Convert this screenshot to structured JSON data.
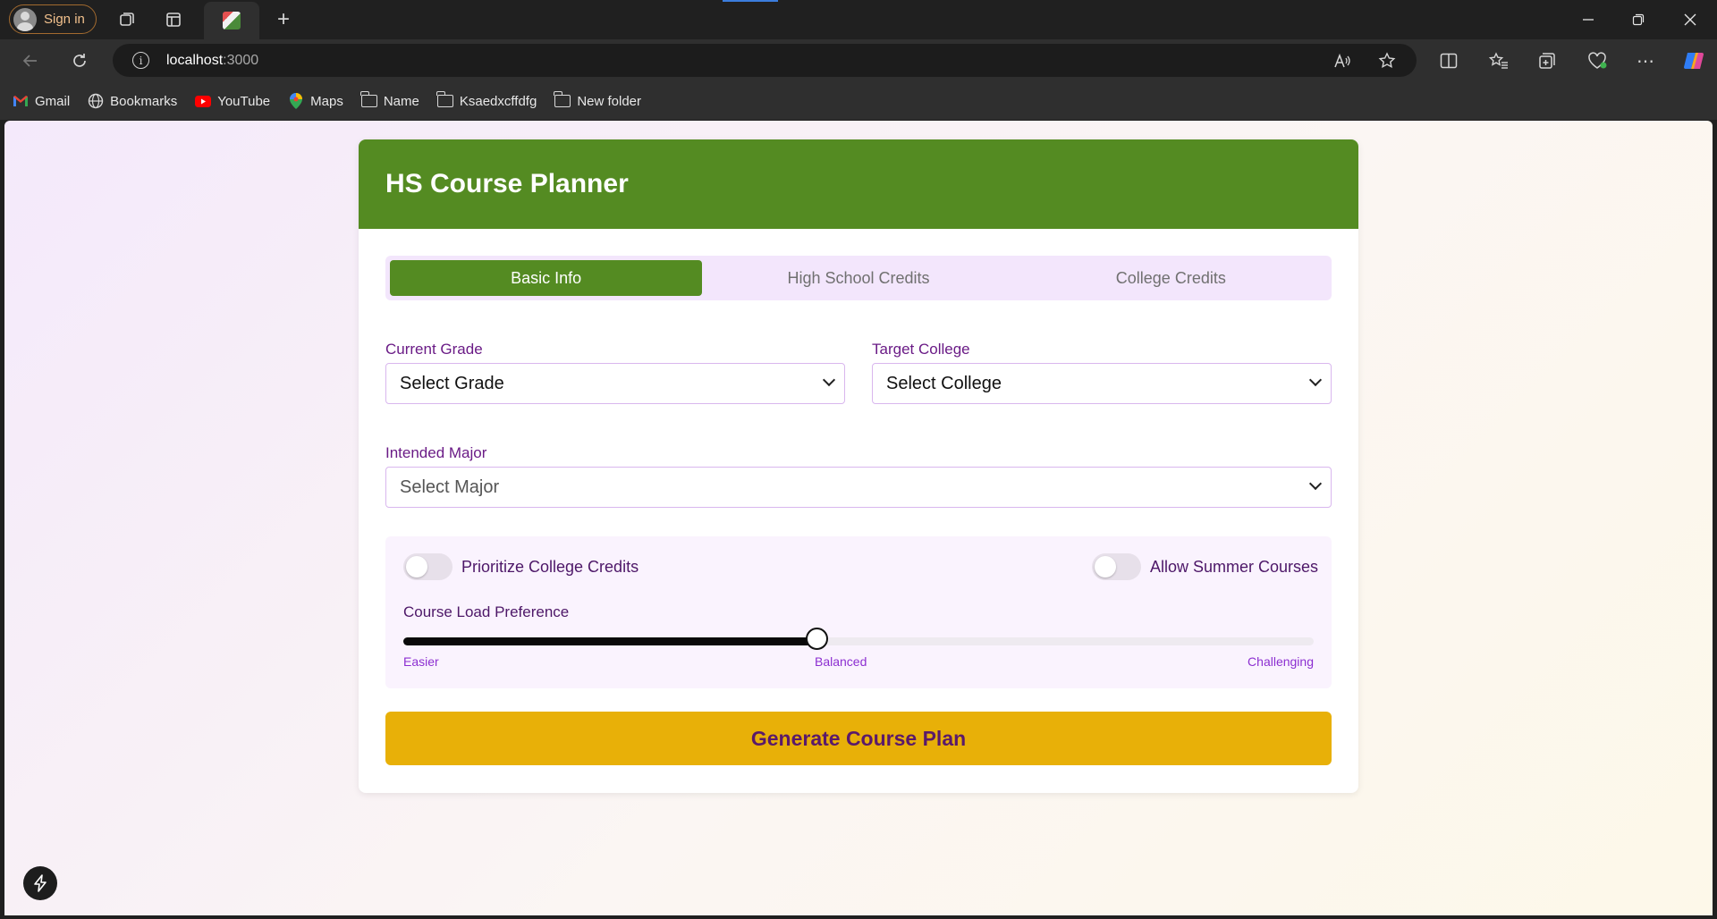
{
  "browser": {
    "signin_label": "Sign in",
    "url_host": "localhost",
    "url_port": ":3000",
    "bookmarks": [
      {
        "label": "Gmail",
        "icon": "gmail-icon"
      },
      {
        "label": "Bookmarks",
        "icon": "globe-icon"
      },
      {
        "label": "YouTube",
        "icon": "youtube-icon"
      },
      {
        "label": "Maps",
        "icon": "maps-icon"
      },
      {
        "label": "Name",
        "icon": "folder-icon"
      },
      {
        "label": "Ksaedxcffdfg",
        "icon": "folder-icon"
      },
      {
        "label": "New folder",
        "icon": "folder-icon"
      }
    ]
  },
  "app": {
    "title": "HS Course Planner",
    "tabs": [
      {
        "label": "Basic Info",
        "active": true
      },
      {
        "label": "High School Credits",
        "active": false
      },
      {
        "label": "College Credits",
        "active": false
      }
    ],
    "fields": {
      "grade_label": "Current Grade",
      "grade_value": "Select Grade",
      "college_label": "Target College",
      "college_value": "Select College",
      "major_label": "Intended Major",
      "major_value": "Select Major"
    },
    "preferences": {
      "prioritize_label": "Prioritize College Credits",
      "prioritize_on": false,
      "summer_label": "Allow Summer Courses",
      "summer_on": false,
      "load_title": "Course Load Preference",
      "load_value_fraction": 0.45,
      "ticks": [
        "Easier",
        "Balanced",
        "Challenging"
      ]
    },
    "generate_label": "Generate Course Plan"
  }
}
